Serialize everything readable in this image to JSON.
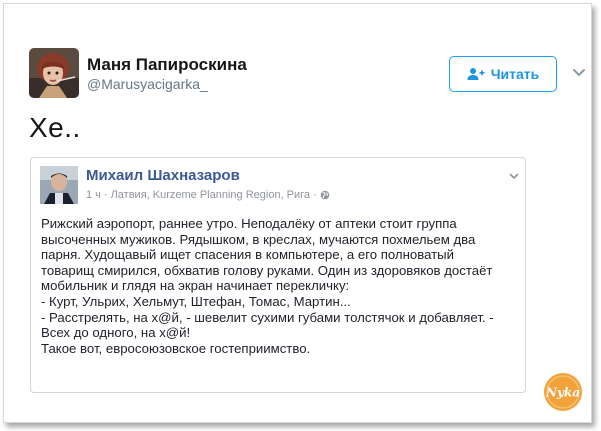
{
  "tweet": {
    "author_name": "Маня Папироскина",
    "author_handle": "@Marusyacigarka_",
    "follow_label": "Читать",
    "text": "Хе.."
  },
  "embedded_post": {
    "author": "Михаил Шахназаров",
    "meta_time": "1 ч",
    "meta_location": "Латвия, Kurzeme Planning Region, Рига",
    "meta_separator": "·",
    "body_lines": [
      "Рижский аэропорт, раннее утро. Неподалёку от аптеки стоит группа",
      "высоченных мужиков. Рядышком, в креслах, мучаются похмельем два",
      "парня. Худощавый ищет спасения в компьютере, а его полноватый",
      "товарищ смирился, обхватив голову руками. Один из здоровяков достаёт",
      "мобильник и глядя на экран начинает перекличку:",
      "- Курт, Ульрих, Хельмут, Штефан, Томас, Мартин...",
      "- Расстрелять, на х@й, - шевелит сухими губами толстячок и добавляет. -",
      "Всех до одного, на х@й!",
      "Такое вот, евросоюзовское гостеприимство."
    ]
  },
  "watermark": {
    "text": "Nyka"
  },
  "colors": {
    "accent": "#1da1f2",
    "fb_link": "#3b5998",
    "muted": "#657786"
  }
}
